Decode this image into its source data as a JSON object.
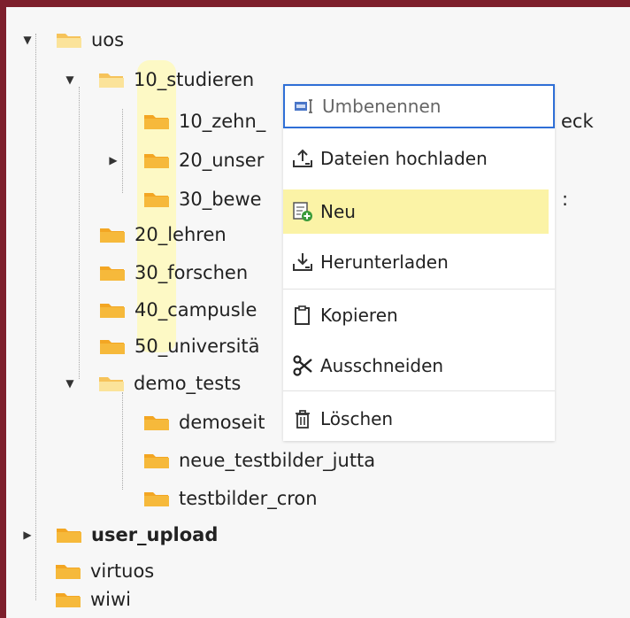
{
  "tree": {
    "items": [
      {
        "label": "uos",
        "bold": false,
        "expanded": true
      },
      {
        "label": "10_studieren",
        "bold": false,
        "expanded": true
      },
      {
        "label": "10_zehn_",
        "bold": false
      },
      {
        "label": "20_unser",
        "bold": false,
        "expanded": false
      },
      {
        "label": "30_bewe",
        "bold": false
      },
      {
        "label": "20_lehren",
        "bold": false
      },
      {
        "label": "30_forschen",
        "bold": false
      },
      {
        "label": "40_campusle",
        "bold": false
      },
      {
        "label": "50_universitä",
        "bold": false
      },
      {
        "label": "demo_tests",
        "bold": false,
        "expanded": true
      },
      {
        "label": "demoseit",
        "bold": false
      },
      {
        "label": "neue_testbilder_jutta",
        "bold": false
      },
      {
        "label": "testbilder_cron",
        "bold": false
      },
      {
        "label": "user_upload",
        "bold": true,
        "expanded": false
      },
      {
        "label": "virtuos",
        "bold": false
      },
      {
        "label": "wiwi",
        "bold": false
      }
    ],
    "peek_right": [
      "eck",
      ":"
    ]
  },
  "context_menu": {
    "items": [
      {
        "label": "Umbenennen",
        "icon": "rename-icon"
      },
      {
        "label": "Dateien hochladen",
        "icon": "upload-icon"
      },
      {
        "label": "Neu",
        "icon": "new-icon"
      },
      {
        "label": "Herunterladen",
        "icon": "download-icon"
      },
      {
        "label": "Kopieren",
        "icon": "copy-icon"
      },
      {
        "label": "Ausschneiden",
        "icon": "scissors-icon"
      },
      {
        "label": "Löschen",
        "icon": "trash-icon"
      }
    ]
  },
  "colors": {
    "frame": "#7d1f2c",
    "folder": "#f6b93b",
    "highlight": "#fbf3a6",
    "focus_border": "#2f6fd6"
  }
}
